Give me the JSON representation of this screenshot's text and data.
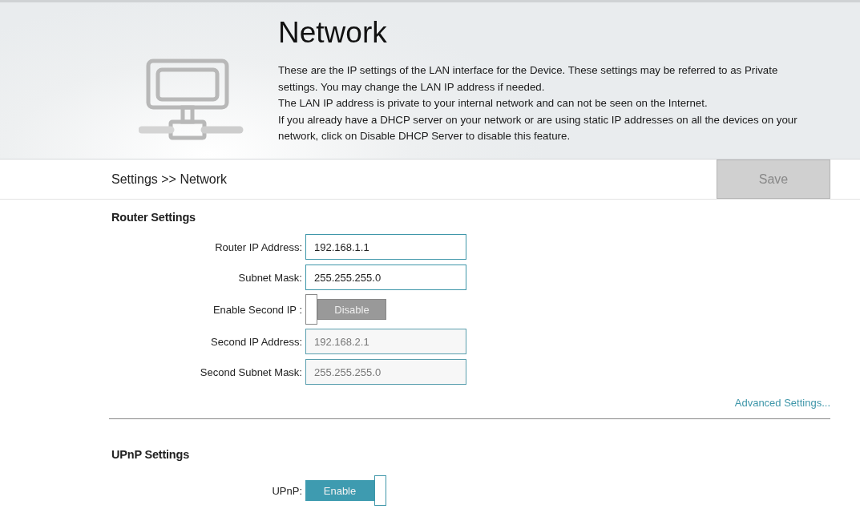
{
  "header": {
    "title": "Network",
    "paragraphs": [
      "These are the IP settings of the LAN interface for the Device. These settings may be referred to as Private settings. You may change the LAN IP address if needed.",
      "The LAN IP address is private to your internal network and can not be seen on the Internet.",
      "If you already have a DHCP server on your network or are using static IP addresses on all the devices on your network, click on Disable DHCP Server to disable this feature."
    ]
  },
  "breadcrumb": "Settings >> Network",
  "save_button": {
    "label": "Save",
    "disabled": true
  },
  "router_settings": {
    "heading": "Router Settings",
    "rows": [
      {
        "kind": "field",
        "label": "Router IP Address:",
        "value": "192.168.1.1",
        "disabled": false
      },
      {
        "kind": "field",
        "label": "Subnet Mask:",
        "value": "255.255.255.0",
        "disabled": false
      },
      {
        "kind": "toggle",
        "label": "Enable Second IP :",
        "text": "Disable",
        "on": false
      },
      {
        "kind": "field",
        "label": "Second IP Address:",
        "value": "192.168.2.1",
        "disabled": true
      },
      {
        "kind": "field",
        "label": "Second Subnet Mask:",
        "value": "255.255.255.0",
        "disabled": true
      }
    ],
    "link": "Advanced Settings..."
  },
  "upnp_settings": {
    "heading": "UPnP Settings",
    "rows": [
      {
        "kind": "toggle",
        "label": "UPnP:",
        "text": "Enable",
        "on": true
      }
    ]
  }
}
